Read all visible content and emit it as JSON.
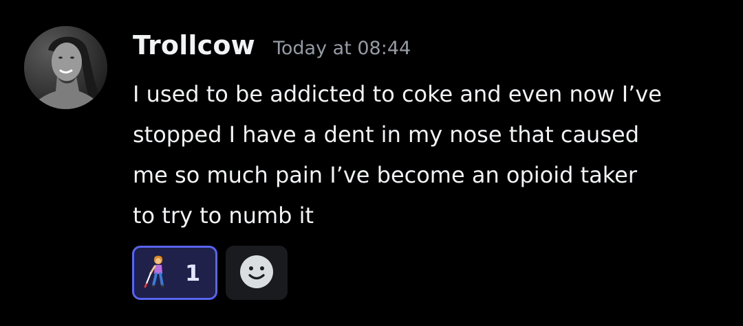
{
  "message": {
    "author": "Trollcow",
    "timestamp": "Today at 08:44",
    "content_lines": [
      "I used to be addicted to coke and even now I’ve",
      "stopped I have a dent in my nose that caused",
      "me so much pain I’ve become an opioid taker",
      "to try to numb it"
    ],
    "avatar_icon": "user-avatar-photo"
  },
  "reactions": [
    {
      "emoji_icon": "person-with-white-cane-icon",
      "count": "1",
      "selected": true
    },
    {
      "emoji_icon": "add-reaction-smiley-icon"
    }
  ],
  "colors": {
    "background": "#000000",
    "text": "#f2f3f5",
    "muted": "#949ba4",
    "reaction_bg": "#20214a",
    "reaction_border": "#5865f2",
    "add_reaction_bg": "#1a1b1e"
  }
}
